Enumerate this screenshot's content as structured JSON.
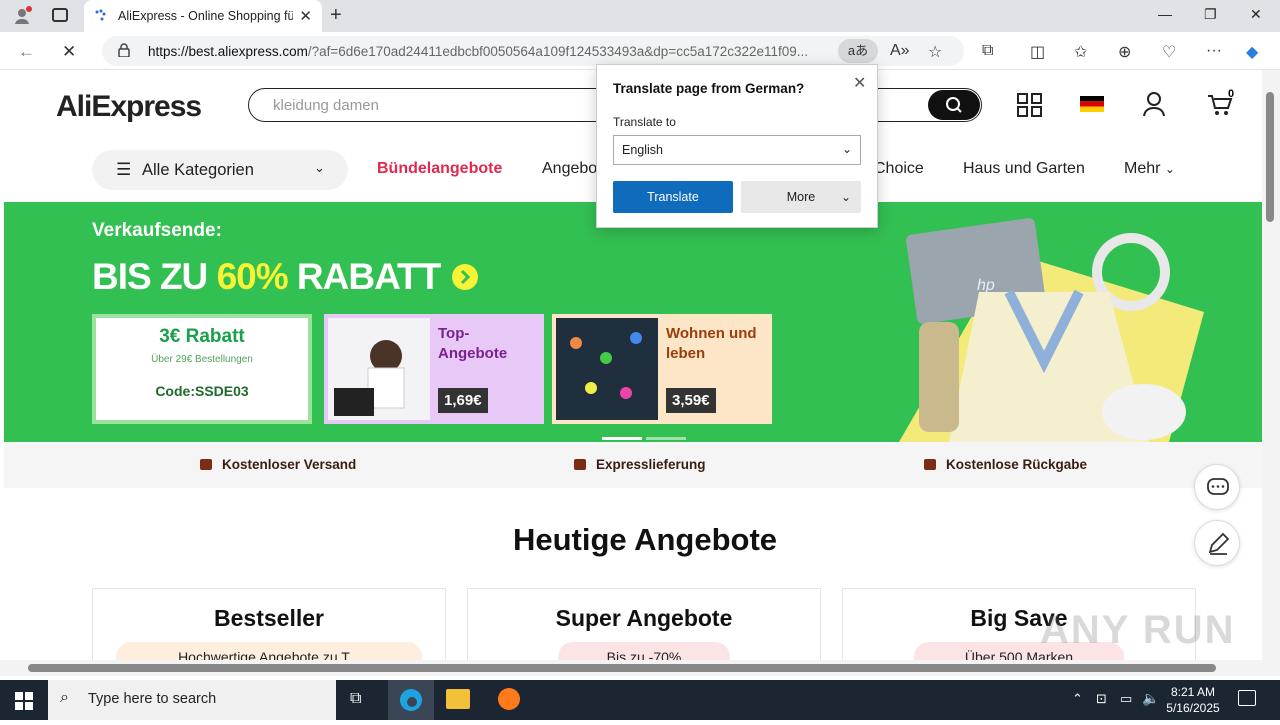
{
  "browser": {
    "tab_title": "AliExpress - Online Shopping für",
    "url_host": "https://best.aliexpress.com",
    "url_rest": "/?af=6d6e170ad24411edbcbf0050564a109f124533493a&dp=cc5a172c322e11f09...",
    "translate_glyph": "aあ"
  },
  "header": {
    "logo": "AliExpress",
    "search_placeholder": "kleidung damen",
    "cart_count": "0"
  },
  "nav": {
    "all_categories": "Alle Kategorien",
    "bundle": "Bündelangebote",
    "deals": "Angebo",
    "choice": "Choice",
    "home_garden": "Haus und Garten",
    "more": "Mehr"
  },
  "banner": {
    "eyebrow": "Verkaufsende:",
    "headline_a": "BIS ZU ",
    "headline_b": "60%",
    "headline_c": " RABATT",
    "coupon_title": "3€ Rabatt",
    "coupon_sub": "Über 29€ Bestellungen",
    "coupon_code": "Code:SSDE03",
    "card2_title": "Top-Angebote",
    "card2_price": "1,69€",
    "card3_title": "Wohnen und leben",
    "card3_price": "3,59€",
    "laptop_brand": "hp"
  },
  "features": [
    "Kostenloser Versand",
    "Expresslieferung",
    "Kostenlose Rückgabe"
  ],
  "section": {
    "title": "Heutige Angebote",
    "boxes": [
      {
        "title": "Bestseller",
        "pill": "Hochwertige Angebote zu T..."
      },
      {
        "title": "Super Angebote",
        "pill": "Bis zu -70%"
      },
      {
        "title": "Big Save",
        "pill": "Über 500 Marken"
      }
    ]
  },
  "translate_popup": {
    "title": "Translate page from German?",
    "label": "Translate to",
    "selected": "English",
    "translate_btn": "Translate",
    "more_btn": "More"
  },
  "taskbar": {
    "search": "Type here to search",
    "time": "8:21 AM",
    "date": "5/16/2025"
  },
  "watermark": "ANY RUN",
  "colors": {
    "banner_green": "#33c052",
    "accent_red": "#e0294f",
    "edge_blue": "#0f6cbd"
  }
}
